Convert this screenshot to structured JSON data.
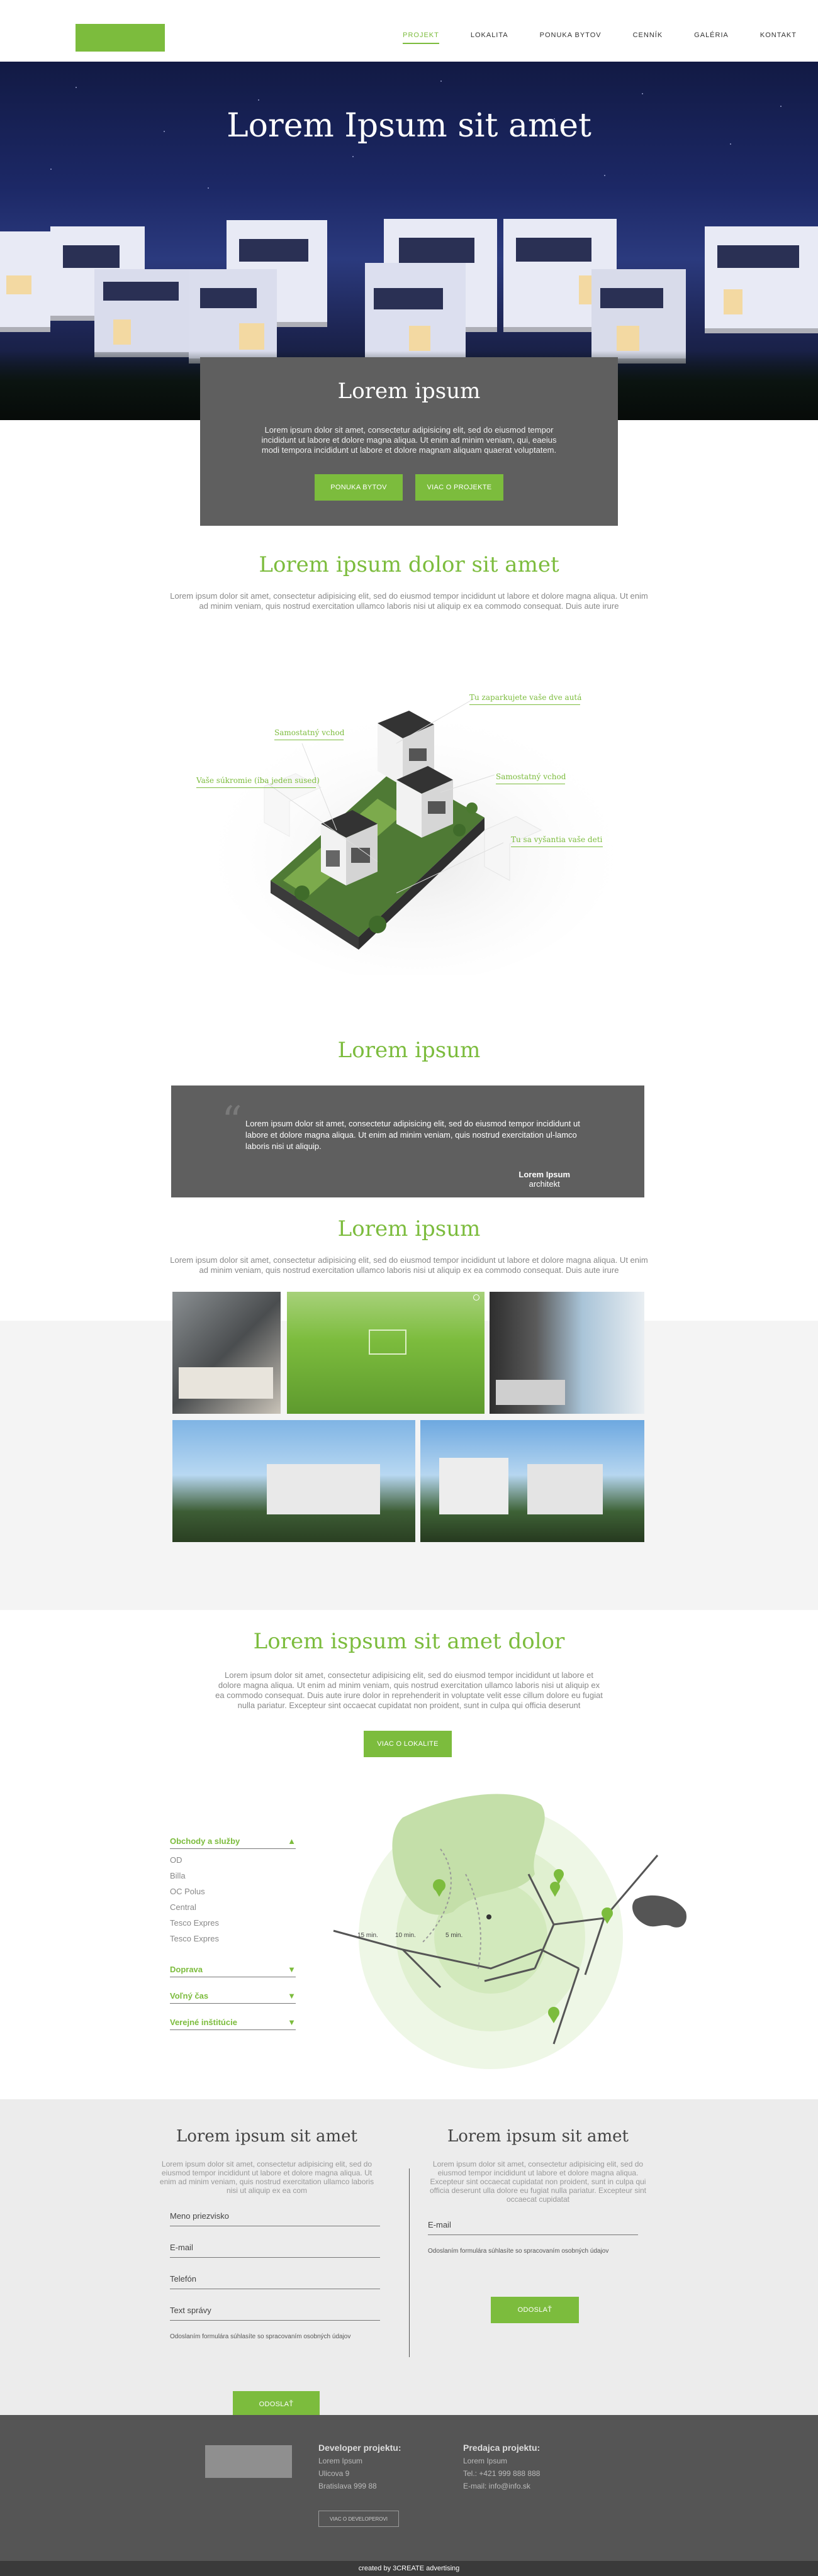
{
  "header": {
    "nav": [
      "PROJEKT",
      "LOKALITA",
      "PONUKA BYTOV",
      "CENNÍK",
      "GALÉRIA",
      "KONTAKT"
    ]
  },
  "hero": {
    "title": "Lorem Ipsum sit amet"
  },
  "intro": {
    "title": "Lorem ipsum",
    "text": "Lorem ipsum dolor sit amet, consectetur adipisicing elit, sed do eiusmod tempor incididunt ut labore et dolore magna aliqua. Ut enim ad minim veniam, qui, eaeius modi tempora incididunt ut labore et dolore magnam aliquam quaerat voluptatem.",
    "btn_left": "PONUKA BYTOV",
    "btn_right": "VIAC O PROJEKTE"
  },
  "section1": {
    "title": "Lorem ipsum dolor sit amet",
    "text": "Lorem ipsum dolor sit amet, consectetur adipisicing elit, sed do eiusmod tempor incididunt ut labore et dolore magna aliqua. Ut enim ad minim veniam, quis nostrud exercitation ullamco laboris nisi ut aliquip ex ea commodo consequat. Duis aute irure"
  },
  "iso_labels": {
    "l1": "Tu zaparkujete vaše dve autá",
    "l2": "Samostatný vchod",
    "l3": "Vaše súkromie (iba jeden sused)",
    "l4": "Samostatný vchod",
    "l5": "Tu sa vyšantia vaše deti"
  },
  "quote_section": {
    "title": "Lorem ipsum",
    "text": "Lorem ipsum dolor sit amet, consectetur adipisicing elit, sed do eiusmod tempor incididunt ut labore et dolore magna aliqua. Ut enim ad minim veniam, quis nostrud exercitation ul-lamco laboris nisi ut aliquip.",
    "author_name": "Lorem Ipsum",
    "author_role": "architekt"
  },
  "gallery_section": {
    "title": "Lorem ipsum",
    "text": "Lorem ipsum dolor sit amet, consectetur adipisicing elit, sed do eiusmod tempor incididunt ut labore et dolore magna aliqua. Ut enim ad minim veniam, quis nostrud exercitation ullamco laboris nisi ut aliquip ex ea commodo consequat. Duis aute irure"
  },
  "location_section": {
    "title": "Lorem ispsum sit amet dolor",
    "text": "Lorem ipsum dolor sit amet, consectetur adipisicing elit, sed do eiusmod tempor incididunt ut labore et dolore magna aliqua. Ut enim ad minim veniam, quis nostrud exercitation ullamco laboris nisi ut aliquip ex ea commodo consequat. Duis aute irure dolor in reprehenderit in voluptate velit esse cillum dolore eu fugiat nulla pariatur. Excepteur sint occaecat cupidatat non proident, sunt in culpa qui officia deserunt",
    "button": "VIAC O LOKALITE"
  },
  "amenities": {
    "cat1": "Obchody a služby",
    "items": [
      "OD",
      "Billa",
      "OC Polus",
      "Central",
      "Tesco Expres",
      "Tesco Expres"
    ],
    "cat2": "Doprava",
    "cat3": "Voľný čas",
    "cat4": "Verejné inštitúcie"
  },
  "map": {
    "t1": "15 min.",
    "t2": "10 min.",
    "t3": "5 min."
  },
  "contact_left": {
    "title": "Lorem ipsum sit amet",
    "text": "Lorem ipsum dolor sit amet, consectetur adipisicing elit, sed do eiusmod tempor incididunt ut labore et dolore magna aliqua. Ut enim ad minim veniam, quis nostrud exercitation ullamco laboris nisi ut aliquip ex ea com",
    "f1": "Meno priezvisko",
    "f2": "E-mail",
    "f3": "Telefón",
    "f4": "Text správy",
    "note": "Odoslaním formulára súhlasíte so spracovaním osobných údajov",
    "button": "ODOSLAŤ"
  },
  "contact_right": {
    "title": "Lorem ipsum sit amet",
    "text": "Lorem ipsum dolor sit amet, consectetur adipisicing elit, sed do eiusmod tempor incididunt ut labore et dolore magna aliqua. Excepteur sint occaecat cupidatat non proident, sunt in culpa qui officia deserunt ulla dolore eu fugiat nulla pariatur. Excepteur sint occaecat cupidatat",
    "f1": "E-mail",
    "note": "Odoslaním formulára súhlasíte so spracovaním osobných údajov",
    "button": "ODOSLAŤ"
  },
  "footer": {
    "dev_title": "Developer projektu:",
    "dev_l1": "Lorem Ipsum",
    "dev_l2": "Ulicova 9",
    "dev_l3": "Bratislava 999 88",
    "dev_btn": "VIAC O DEVELOPEROVI",
    "sales_title": "Predajca projektu:",
    "sales_l1": "Lorem Ipsum",
    "sales_l2": "Tel.: +421 999 888 888",
    "sales_l3": "E-mail: info@info.sk",
    "bottom": "created by 3CREATE advertising"
  }
}
